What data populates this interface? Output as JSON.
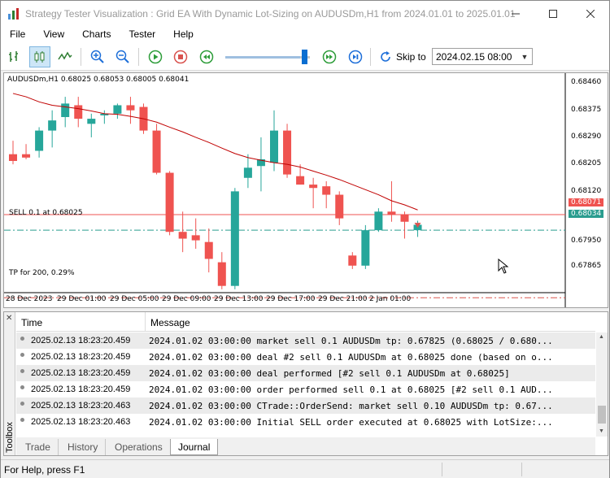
{
  "window": {
    "title": "Strategy Tester Visualization : Grid EA With Dynamic Lot-Sizing on AUDUSDm,H1 from 2024.01.01 to 2025.01.01"
  },
  "menu": [
    "File",
    "View",
    "Charts",
    "Tester",
    "Help"
  ],
  "toolbar": {
    "skip_to_label": "Skip to",
    "skip_to_value": "2024.02.15 08:00",
    "speed_fraction": 0.88
  },
  "chart": {
    "header": "AUDUSDm,H1  0.68025 0.68053 0.68005 0.68041",
    "price_axis": [
      "0.68460",
      "0.68375",
      "0.68290",
      "0.68205",
      "0.68120",
      "0.68034",
      "0.67950",
      "0.67865"
    ],
    "red_price_tag": "0.68071",
    "green_price_tag": "0.68034",
    "time_axis": [
      "28 Dec 2023",
      "29 Dec 01:00",
      "29 Dec 05:00",
      "29 Dec 09:00",
      "29 Dec 13:00",
      "29 Dec 17:00",
      "29 Dec 21:00",
      "2 Jan 01:00"
    ],
    "sell_label": "SELL 0.1 at 0.68025",
    "tp_label": "TP for 200, 0.29%",
    "colors": {
      "bull": "#26a69a",
      "bear": "#ef5350",
      "ma": "#c00000",
      "sell_line": "#2a9d8f",
      "tp_line": "#d9534f"
    }
  },
  "chart_data": {
    "type": "candlestick",
    "symbol": "AUDUSDm",
    "timeframe": "H1",
    "ohlc": [
      [
        0.6825,
        0.6829,
        0.6822,
        0.6823
      ],
      [
        0.6825,
        0.6828,
        0.68235,
        0.6824
      ],
      [
        0.6826,
        0.6833,
        0.6824,
        0.6832
      ],
      [
        0.6832,
        0.6838,
        0.6827,
        0.6835
      ],
      [
        0.6836,
        0.6842,
        0.6833,
        0.684
      ],
      [
        0.68395,
        0.6842,
        0.6833,
        0.68355
      ],
      [
        0.6834,
        0.6837,
        0.683,
        0.68355
      ],
      [
        0.68365,
        0.6838,
        0.6834,
        0.6837
      ],
      [
        0.6837,
        0.684,
        0.68355,
        0.68395
      ],
      [
        0.68395,
        0.6842,
        0.6834,
        0.6838
      ],
      [
        0.6839,
        0.684,
        0.6831,
        0.6832
      ],
      [
        0.6832,
        0.6834,
        0.6819,
        0.68195
      ],
      [
        0.68195,
        0.682,
        0.6801,
        0.6802
      ],
      [
        0.6802,
        0.6808,
        0.6796,
        0.68
      ],
      [
        0.6801,
        0.6806,
        0.6797,
        0.67995
      ],
      [
        0.6799,
        0.6803,
        0.679,
        0.6794
      ],
      [
        0.6793,
        0.6796,
        0.6785,
        0.6786
      ],
      [
        0.6786,
        0.6815,
        0.6785,
        0.6814
      ],
      [
        0.6818,
        0.6825,
        0.6815,
        0.6821
      ],
      [
        0.68215,
        0.683,
        0.6814,
        0.68235
      ],
      [
        0.68225,
        0.6838,
        0.682,
        0.6832
      ],
      [
        0.6832,
        0.6834,
        0.6818,
        0.6819
      ],
      [
        0.68185,
        0.6822,
        0.6816,
        0.6816
      ],
      [
        0.6816,
        0.6818,
        0.6809,
        0.6815
      ],
      [
        0.68155,
        0.6817,
        0.6809,
        0.6813
      ],
      [
        0.6813,
        0.6814,
        0.6804,
        0.6806
      ],
      [
        0.6795,
        0.6796,
        0.6791,
        0.6792
      ],
      [
        0.6792,
        0.6804,
        0.6791,
        0.68025
      ],
      [
        0.68025,
        0.6809,
        0.6802,
        0.6808
      ],
      [
        0.6808,
        0.6817,
        0.6805,
        0.6807
      ],
      [
        0.6807,
        0.6808,
        0.68,
        0.6805
      ],
      [
        0.68025,
        0.68053,
        0.68005,
        0.68041
      ]
    ],
    "moving_average": [
      0.6843,
      0.6842,
      0.68405,
      0.68395,
      0.6839,
      0.68385,
      0.68378,
      0.6837,
      0.68368,
      0.68362,
      0.68355,
      0.68345,
      0.6833,
      0.68316,
      0.683,
      0.68285,
      0.68268,
      0.68252,
      0.6824,
      0.68232,
      0.68225,
      0.6822,
      0.68212,
      0.682,
      0.68188,
      0.68175,
      0.6816,
      0.68145,
      0.6813,
      0.68112,
      0.681,
      0.68085
    ],
    "ylim": [
      0.6784,
      0.6849
    ],
    "sell_level": 0.68025,
    "red_level": 0.68071,
    "tp_level": 0.67825
  },
  "journal": {
    "columns": [
      "Time",
      "Message"
    ],
    "rows": [
      {
        "time": "2025.02.13 18:23:20.459",
        "msg": "2024.01.02 03:00:00   market sell 0.1 AUDUSDm tp: 0.67825 (0.68025 / 0.680..."
      },
      {
        "time": "2025.02.13 18:23:20.459",
        "msg": "2024.01.02 03:00:00   deal #2 sell 0.1 AUDUSDm at 0.68025 done (based on o..."
      },
      {
        "time": "2025.02.13 18:23:20.459",
        "msg": "2024.01.02 03:00:00   deal performed [#2 sell 0.1 AUDUSDm at 0.68025]"
      },
      {
        "time": "2025.02.13 18:23:20.459",
        "msg": "2024.01.02 03:00:00   order performed sell 0.1 at 0.68025 [#2 sell 0.1 AUD..."
      },
      {
        "time": "2025.02.13 18:23:20.463",
        "msg": "2024.01.02 03:00:00   CTrade::OrderSend: market sell 0.10 AUDUSDm tp: 0.67..."
      },
      {
        "time": "2025.02.13 18:23:20.463",
        "msg": "2024.01.02 03:00:00   Initial SELL order executed at 0.68025 with LotSize:..."
      }
    ]
  },
  "tabs": [
    "Trade",
    "History",
    "Operations",
    "Journal"
  ],
  "active_tab": "Journal",
  "toolbox_label": "Toolbox",
  "status": {
    "text": "For Help, press F1"
  }
}
